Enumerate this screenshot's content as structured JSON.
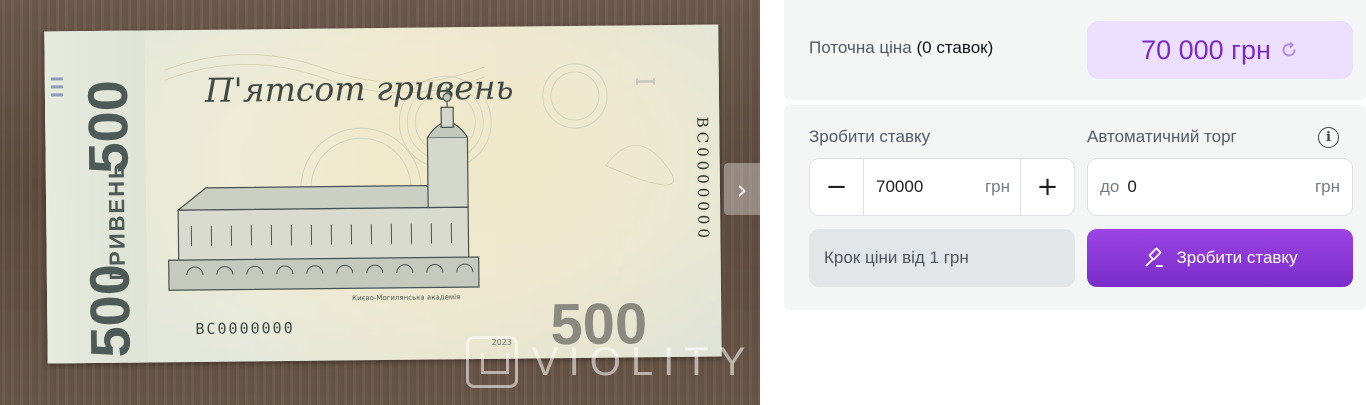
{
  "listing": {
    "image": {
      "title_script": "П'ятсот гривень",
      "denomination": "500",
      "currency_word": "ГРИВЕНЬ",
      "serial_number": "ВС0000000",
      "serial_vertical": "ВС0000000",
      "building_caption": "Києво-Могилянська академія",
      "year": "2023",
      "watermark_text": "VIOLITY",
      "next_icon": "chevron-right-icon"
    }
  },
  "auction": {
    "current_price_label": "Поточна ціна",
    "bids_count_text": "(0 ставок)",
    "current_price": "70 000 грн",
    "place_bid_section_label": "Зробити ставку",
    "auto_bid_section_label": "Автоматичний торг",
    "bid_input": {
      "value": "70000",
      "unit": "грн"
    },
    "stepper": {
      "minus": "−",
      "plus": "+"
    },
    "auto_bid_input": {
      "prefix": "до",
      "value": "0",
      "unit": "грн"
    },
    "step_text": "Крок ціни від 1 грн",
    "bid_button_label": "Зробити ставку",
    "accent_color": "#7a2cc9",
    "price_bg_color": "#eddfff"
  }
}
